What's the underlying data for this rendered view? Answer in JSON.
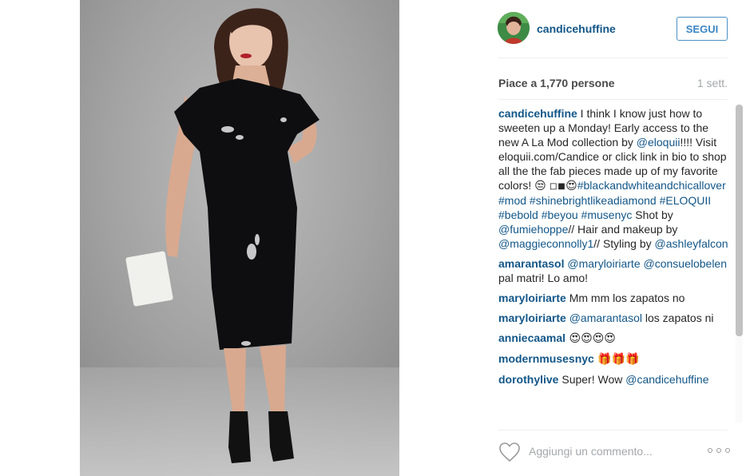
{
  "post": {
    "author": "candicehuffine",
    "follow_label": "SEGUI",
    "likes_text": "Piace a 1,770 persone",
    "time_text": "1 sett.",
    "add_comment_placeholder": "Aggiungi un commento...",
    "more_label": "..."
  },
  "caption": {
    "user": "candicehuffine",
    "t1": " I think I know just how to sweeten up a Monday! Early access to the new A La Mod collection by ",
    "m1": "@eloquii",
    "t2": "!!!! Visit eloquii.com/Candice or click link in bio to shop all the the fab pieces made up of my favorite colors! ",
    "e1": "😒",
    "e2": "◽◾😍",
    "h1": "#blackandwhiteandchicallover",
    "h2": "#mod",
    "h3": "#shinebrightlikeadiamond",
    "h4": "#ELOQUII",
    "h5": "#bebold",
    "h6": "#beyou",
    "h7": "#musenyc",
    "t3": "Shot by ",
    "m2": "@fumiehoppe",
    "t4": "// Hair and makeup by ",
    "m3": "@maggieconnolly1",
    "t5": "// Styling by ",
    "m4": "@ashleyfalcon"
  },
  "comments": [
    {
      "user": "amarantasol",
      "mention1": "@maryloiriarte",
      "mention2": "@consuelobelen",
      "text": " pal matri! Lo amo!"
    },
    {
      "user": "maryloiriarte",
      "text": " Mm mm los zapatos no"
    },
    {
      "user": "maryloiriarte",
      "mention1": "@amarantasol",
      "text": " los zapatos ni"
    },
    {
      "user": "anniecaamal",
      "text": " 😍😍😍😍"
    },
    {
      "user": "modernmusesnyc",
      "text": " 🎁🎁🎁"
    },
    {
      "user": "dorothylive",
      "text": " Super! Wow ",
      "mention1": "@candicehuffine"
    }
  ],
  "icons": {
    "avatar": "profile-photo",
    "heart": "heart-outline-icon",
    "more": "ellipsis-icon"
  },
  "colors": {
    "link": "#125688",
    "follow": "#3b86c4",
    "muted": "#a5a7aa"
  }
}
